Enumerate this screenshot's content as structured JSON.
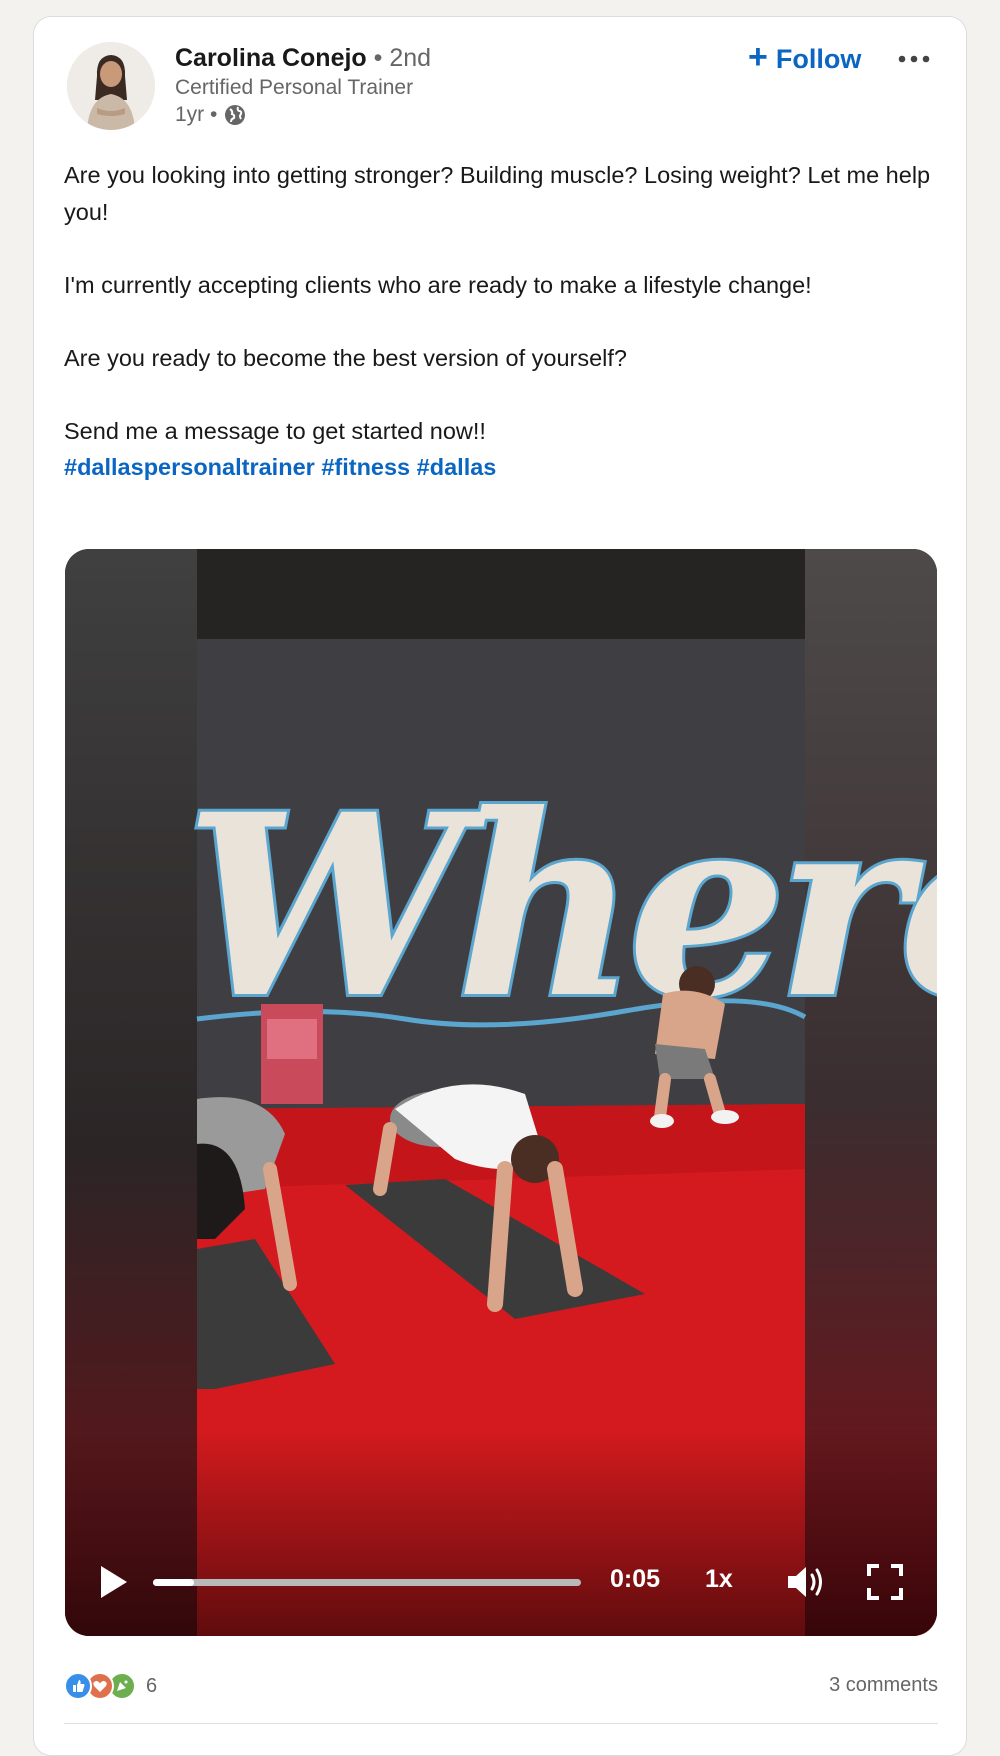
{
  "post": {
    "author": {
      "name": "Carolina Conejo",
      "degree": " • 2nd",
      "headline": "Certified Personal Trainer",
      "age": "1yr •",
      "visibility_icon": "globe-icon"
    },
    "follow_label": "Follow",
    "more_icon": "more-horizontal-icon",
    "body": [
      "Are you looking into getting stronger? Building muscle? Losing weight? Let me help you!",
      "I'm currently accepting clients who are ready to make a lifestyle change!",
      "Are you ready to become the best version of yourself?",
      "Send me a message to get started now!!"
    ],
    "hashtags": [
      "#dallaspersonaltrainer",
      "#fitness",
      "#dallas"
    ],
    "video": {
      "overlay_text": "Where",
      "time": "0:05",
      "speed": "1x",
      "progress": 0.095
    },
    "social": {
      "reaction_icons": [
        "like-icon",
        "love-icon",
        "celebrate-icon"
      ],
      "reaction_count": "6",
      "comments": "3 comments"
    }
  },
  "colors": {
    "accent": "#0a66c2",
    "text": "#191919",
    "muted": "#666666",
    "mat_red": "#d41a1e"
  }
}
